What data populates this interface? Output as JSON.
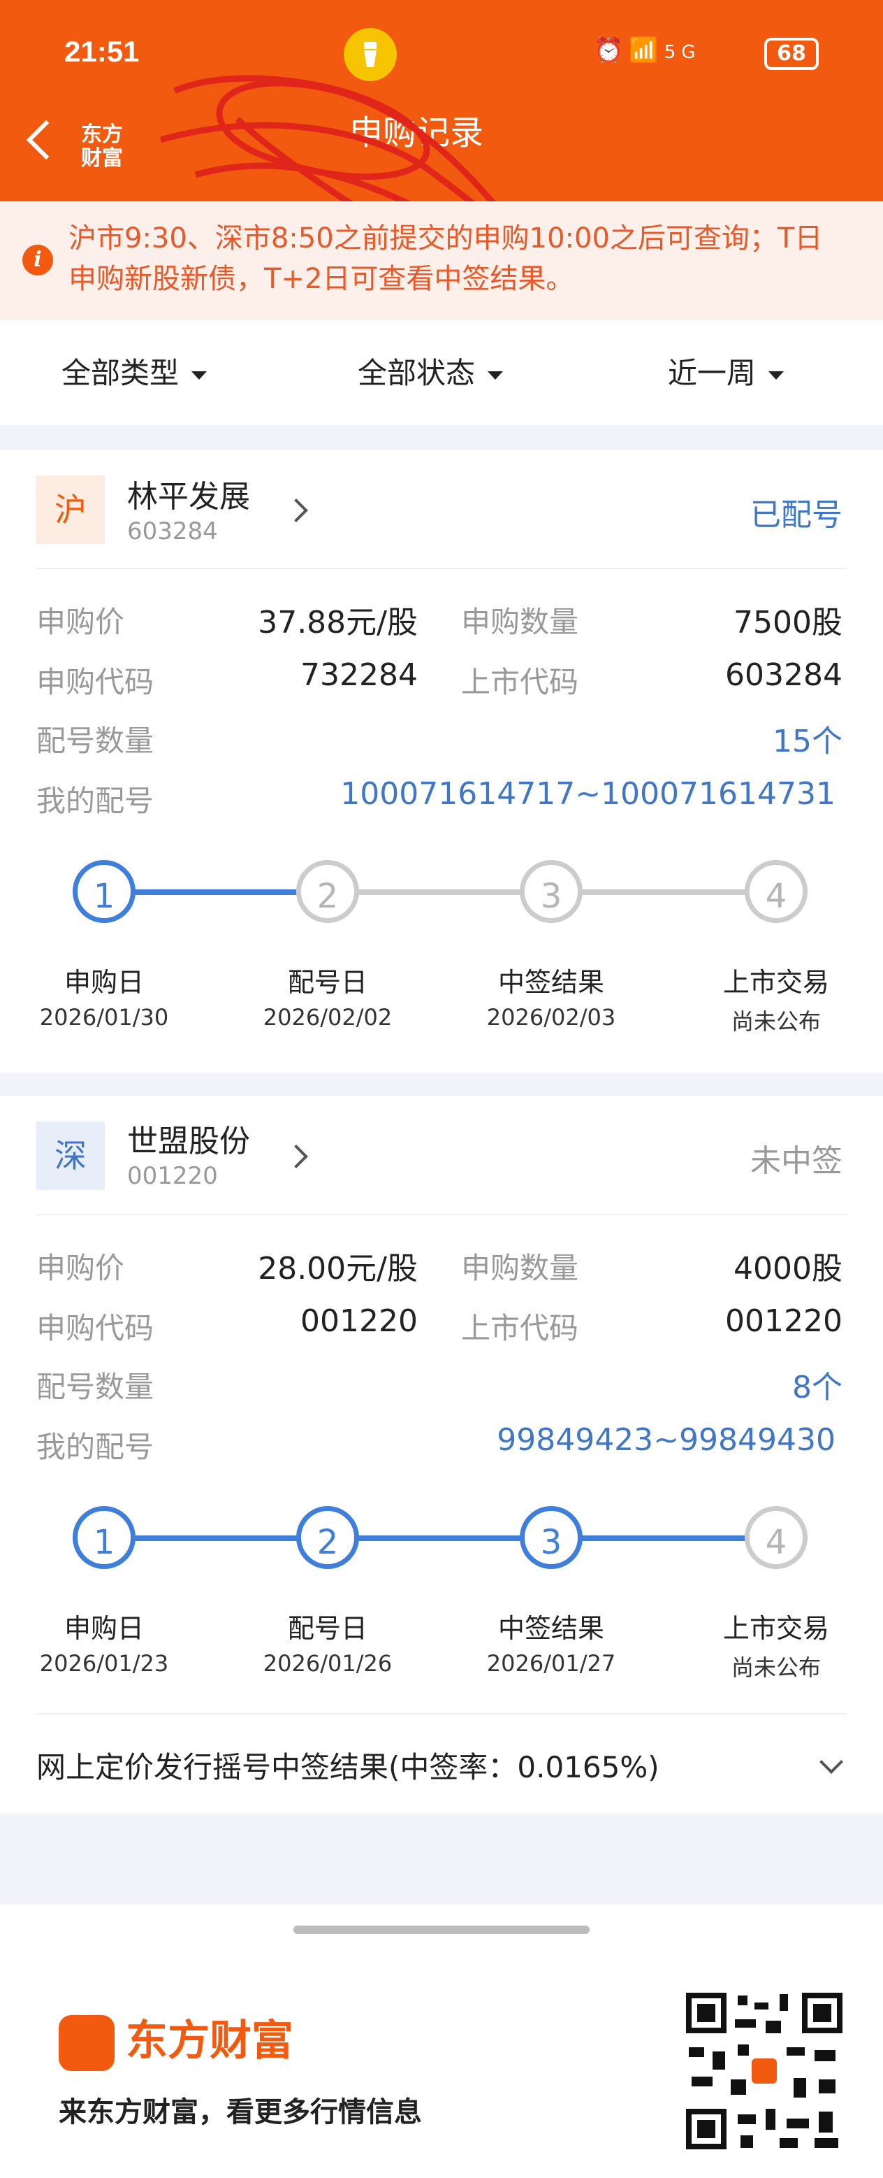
{
  "status_bar": {
    "time": "21:51",
    "signal": "5G",
    "battery": "68"
  },
  "header": {
    "title": "申购记录",
    "logo_text": "东方财富"
  },
  "notice": {
    "text": "沪市9:30、深市8:50之前提交的申购10:00之后可查询；T日申购新股新债，T+2日可查看中签结果。"
  },
  "filters": {
    "type": "全部类型",
    "status": "全部状态",
    "period": "近一周"
  },
  "labels": {
    "price": "申购价",
    "qty": "申购数量",
    "sub_code": "申购代码",
    "list_code": "上市代码",
    "alloc_count": "配号数量",
    "my_alloc": "我的配号"
  },
  "records": [
    {
      "market": "沪",
      "name": "林平发展",
      "code": "603284",
      "status": "已配号",
      "price": "37.88元/股",
      "qty": "7500股",
      "sub_code": "732284",
      "list_code": "603284",
      "alloc_count": "15个",
      "my_alloc": "100071614717~100071614731",
      "steps": [
        {
          "num": "1",
          "label": "申购日",
          "date": "2026/01/30"
        },
        {
          "num": "2",
          "label": "配号日",
          "date": "2026/02/02"
        },
        {
          "num": "3",
          "label": "中签结果",
          "date": "2026/02/03"
        },
        {
          "num": "4",
          "label": "上市交易",
          "date": "尚未公布"
        }
      ]
    },
    {
      "market": "深",
      "name": "世盟股份",
      "code": "001220",
      "status": "未中签",
      "price": "28.00元/股",
      "qty": "4000股",
      "sub_code": "001220",
      "list_code": "001220",
      "alloc_count": "8个",
      "my_alloc": "99849423~99849430",
      "steps": [
        {
          "num": "1",
          "label": "申购日",
          "date": "2026/01/23"
        },
        {
          "num": "2",
          "label": "配号日",
          "date": "2026/01/26"
        },
        {
          "num": "3",
          "label": "中签结果",
          "date": "2026/01/27"
        },
        {
          "num": "4",
          "label": "上市交易",
          "date": "尚未公布"
        }
      ],
      "lottery_result": "网上定价发行摇号中签结果(中签率：0.0165%)"
    }
  ],
  "footer": {
    "brand": "东方财富",
    "slogan": "来东方财富，看更多行情信息"
  },
  "colors": {
    "brand": "#f15a0f",
    "blue": "#3d7fdb",
    "notice_text": "#e8592a"
  }
}
